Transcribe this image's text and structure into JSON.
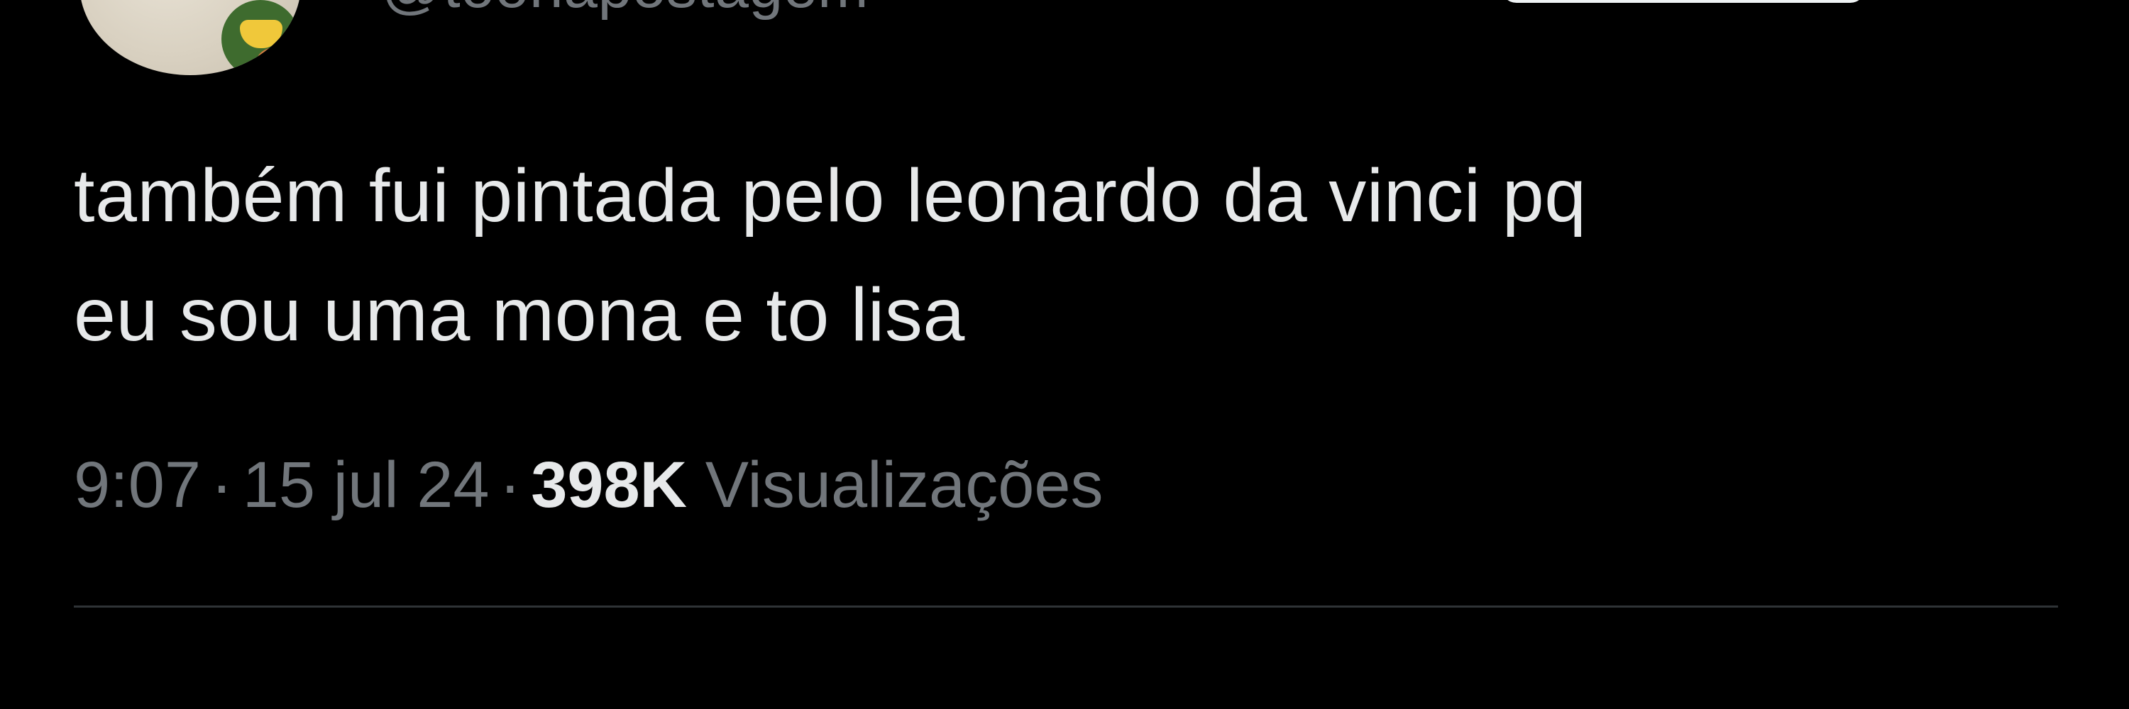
{
  "author": {
    "handle": "@toonapostagem"
  },
  "follow_button": {
    "label": ""
  },
  "tweet": {
    "text_lines": [
      "também fui pintada pelo leonardo da vinci pq",
      "eu sou uma mona e to lisa"
    ]
  },
  "meta": {
    "time": "9:07",
    "separator": "·",
    "date": "15 jul 24",
    "views_count": "398K",
    "views_label": "Visualizações"
  },
  "colors": {
    "background": "#000000",
    "primary_text": "#e7e9ea",
    "secondary_text": "#71767b",
    "divider": "#2f3336"
  }
}
